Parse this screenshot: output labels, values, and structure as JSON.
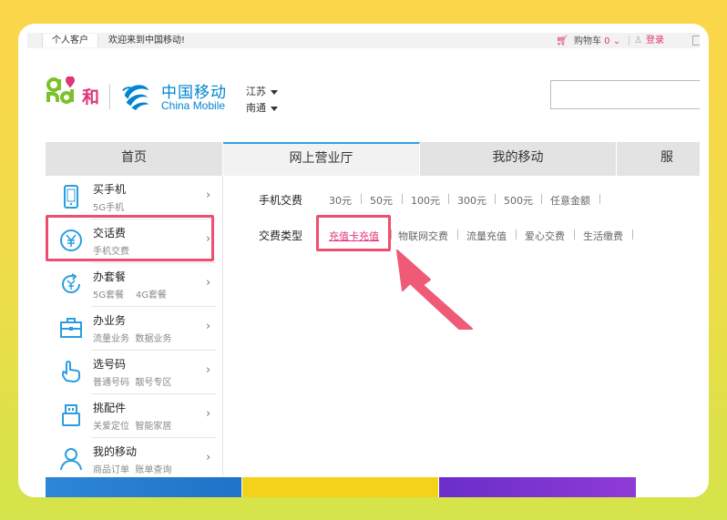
{
  "topbar": {
    "customer_type": "个人客户",
    "welcome": "欢迎来到中国移动!",
    "cart_label": "购物车",
    "cart_count": "0",
    "login_label": "登录"
  },
  "header": {
    "brand_he": "和",
    "brand_cn": "中国移动",
    "brand_en": "China Mobile",
    "province": "江苏",
    "city": "南通"
  },
  "nav": {
    "tabs": [
      {
        "label": "首页"
      },
      {
        "label": "网上营业厅"
      },
      {
        "label": "我的移动"
      },
      {
        "label": "服"
      }
    ]
  },
  "sidebar": {
    "items": [
      {
        "title": "买手机",
        "sub": "5G手机",
        "icon": "phone-icon"
      },
      {
        "title": "交话费",
        "sub": "手机交费",
        "icon": "yuan-circle-icon"
      },
      {
        "title": "办套餐",
        "sub": "5G套餐    4G套餐",
        "icon": "yuan-refresh-icon"
      },
      {
        "title": "办业务",
        "sub": "流量业务  数据业务",
        "icon": "briefcase-icon"
      },
      {
        "title": "选号码",
        "sub": "普通号码  靓号专区",
        "icon": "hand-point-icon"
      },
      {
        "title": "挑配件",
        "sub": "关爱定位  智能家居",
        "icon": "usb-icon"
      },
      {
        "title": "我的移动",
        "sub": "商品订单  账单查询",
        "icon": "user-icon"
      }
    ]
  },
  "content": {
    "recharge_label": "手机交费",
    "amounts": [
      "30元",
      "50元",
      "100元",
      "300元",
      "500元",
      "任意金额"
    ],
    "type_label": "交费类型",
    "types": [
      "充值卡充值",
      "物联网交费",
      "流量充值",
      "爱心交费",
      "生活缴费"
    ]
  },
  "colors": {
    "accent_pink": "#e0357a",
    "brand_blue": "#0085d0",
    "highlight_red": "#ee4f6e",
    "nav_active_blue": "#2aa2e8"
  }
}
